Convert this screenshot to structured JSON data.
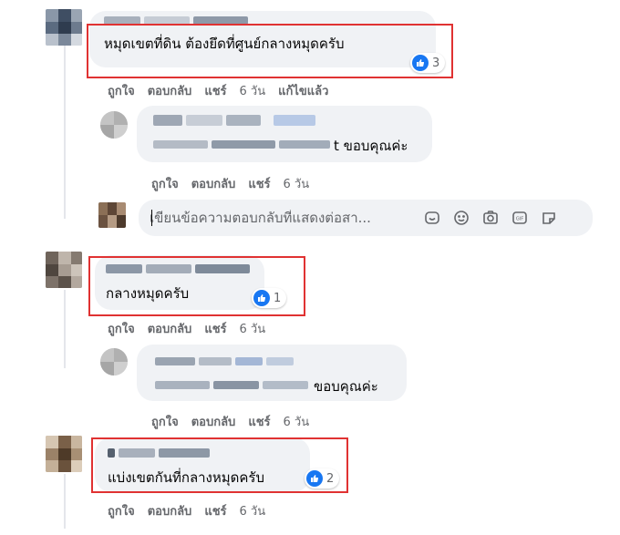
{
  "comments": [
    {
      "text": "หมุดเขตที่ดิน ต้องยึดที่ศูนย์กลางหมุดครับ",
      "reaction_count": "3",
      "actions": {
        "like": "ถูกใจ",
        "reply": "ตอบกลับ",
        "share": "แชร์",
        "time": "6 วัน",
        "edited": "แก้ไขแล้ว"
      },
      "replies": [
        {
          "text": "t ขอบคุณค่ะ",
          "actions": {
            "like": "ถูกใจ",
            "reply": "ตอบกลับ",
            "share": "แชร์",
            "time": "6 วัน"
          }
        }
      ],
      "reply_box": {
        "placeholder": "เขียนข้อความตอบกลับที่แสดงต่อสา..."
      }
    },
    {
      "text": "กลางหมุดครับ",
      "reaction_count": "1",
      "actions": {
        "like": "ถูกใจ",
        "reply": "ตอบกลับ",
        "share": "แชร์",
        "time": "6 วัน"
      },
      "replies": [
        {
          "text": "ขอบคุณค่ะ",
          "actions": {
            "like": "ถูกใจ",
            "reply": "ตอบกลับ",
            "share": "แชร์",
            "time": "6 วัน"
          }
        }
      ]
    },
    {
      "text": "แบ่งเขตกันที่กลางหมุดครับ",
      "reaction_count": "2",
      "actions": {
        "like": "ถูกใจ",
        "reply": "ตอบกลับ",
        "share": "แชร์",
        "time": "6 วัน"
      }
    }
  ],
  "icons": {
    "reaction": "like-reaction-icon",
    "reply_tools": [
      "sticker-icon",
      "emoji-icon",
      "camera-icon",
      "gif-icon",
      "avatar-sticker-icon"
    ]
  },
  "colors": {
    "bubble": "#f0f2f5",
    "highlight_box": "#e03232",
    "like_blue": "#1877f2",
    "meta_text": "#65676b"
  }
}
